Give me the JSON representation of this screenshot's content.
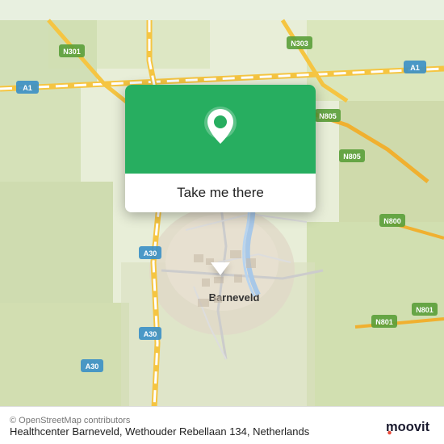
{
  "map": {
    "background_color": "#e8eed8",
    "alt": "Map of Barneveld, Netherlands"
  },
  "popup": {
    "button_label": "Take me there",
    "green_color": "#27ae60",
    "pin_color": "white"
  },
  "bottom_bar": {
    "address": "Healthcenter Barneveld, Wethouder Rebellaan 134,",
    "country": "Netherlands",
    "copyright": "© OpenStreetMap contributors",
    "logo_text": "moovit"
  }
}
